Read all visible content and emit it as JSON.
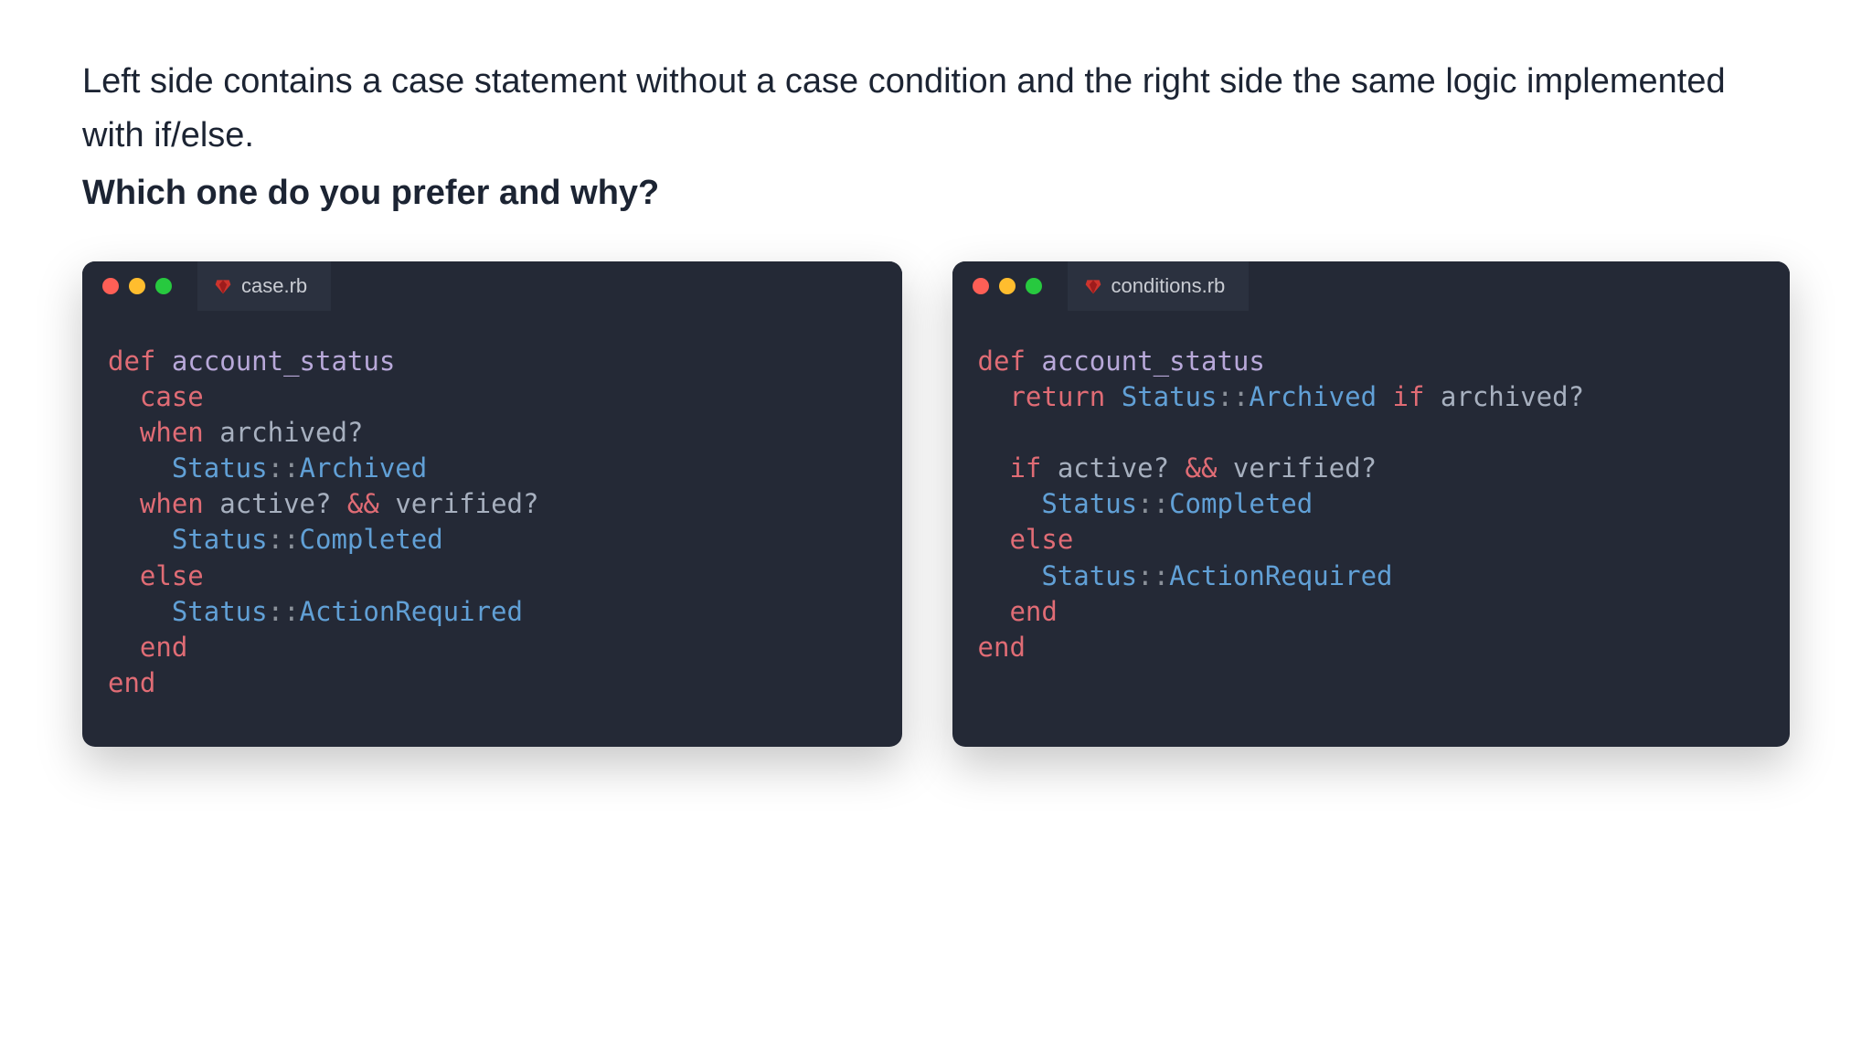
{
  "description": "Left side contains a case statement without a case condition and the right side the same logic implemented with if/else.",
  "question": "Which one do you prefer and why?",
  "left": {
    "filename": "case.rb",
    "tokens": {
      "def": "def",
      "fn": "account_status",
      "case": "case",
      "when": "when",
      "archived_q": "archived?",
      "status": "Status",
      "dcolon": "::",
      "archived": "Archived",
      "active_q": "active?",
      "amp": "&&",
      "verified_q": "verified?",
      "completed": "Completed",
      "else": "else",
      "action_required": "ActionRequired",
      "end": "end"
    }
  },
  "right": {
    "filename": "conditions.rb",
    "tokens": {
      "def": "def",
      "fn": "account_status",
      "return": "return",
      "status": "Status",
      "dcolon": "::",
      "archived": "Archived",
      "if": "if",
      "archived_q": "archived?",
      "active_q": "active?",
      "amp": "&&",
      "verified_q": "verified?",
      "completed": "Completed",
      "else": "else",
      "action_required": "ActionRequired",
      "end": "end"
    }
  },
  "colors": {
    "window_bg": "#242936",
    "tab_bg": "#2b313f",
    "keyword": "#e06c75",
    "method_name": "#b8a8d9",
    "identifier": "#a7b0bf",
    "constant": "#61a0d6",
    "dot_red": "#ff5f56",
    "dot_yellow": "#ffbd2e",
    "dot_green": "#27c93f"
  }
}
